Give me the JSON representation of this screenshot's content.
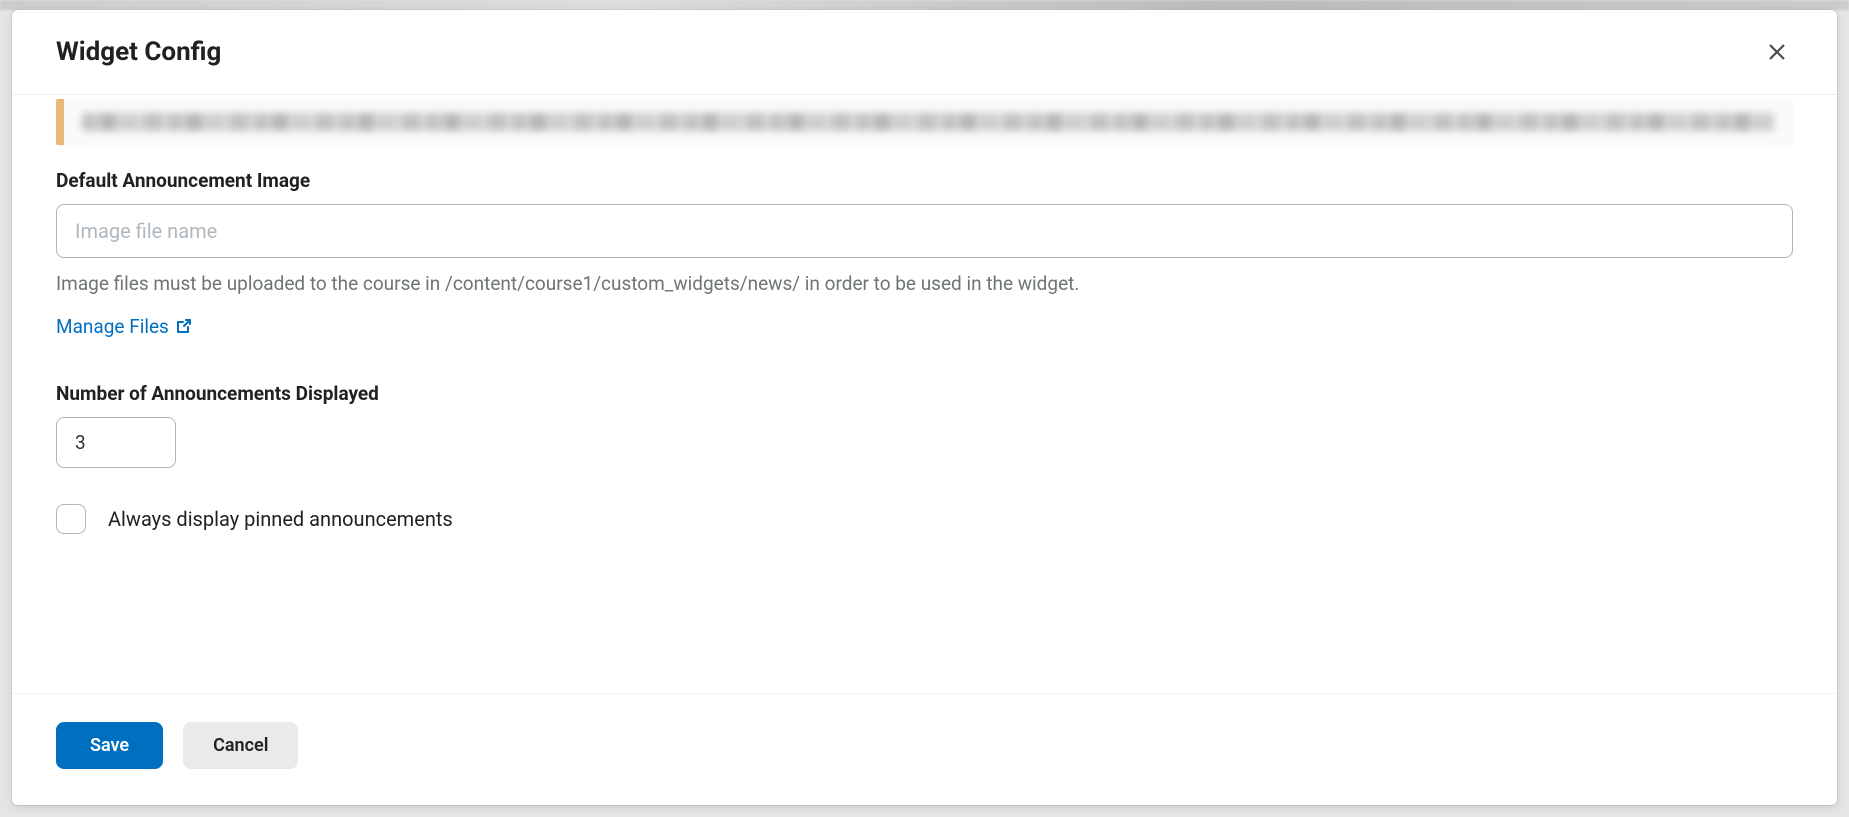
{
  "modal": {
    "title": "Widget Config"
  },
  "form": {
    "imageLabel": "Default Announcement Image",
    "imagePlaceholder": "Image file name",
    "imageValue": "",
    "imageHelp": "Image files must be uploaded to the course in /content/course1/custom_widgets/news/ in order to be used in the widget.",
    "manageFilesLabel": "Manage Files",
    "countLabel": "Number of Announcements Displayed",
    "countValue": "3",
    "pinnedLabel": "Always display pinned announcements",
    "pinnedChecked": false
  },
  "footer": {
    "saveLabel": "Save",
    "cancelLabel": "Cancel"
  }
}
